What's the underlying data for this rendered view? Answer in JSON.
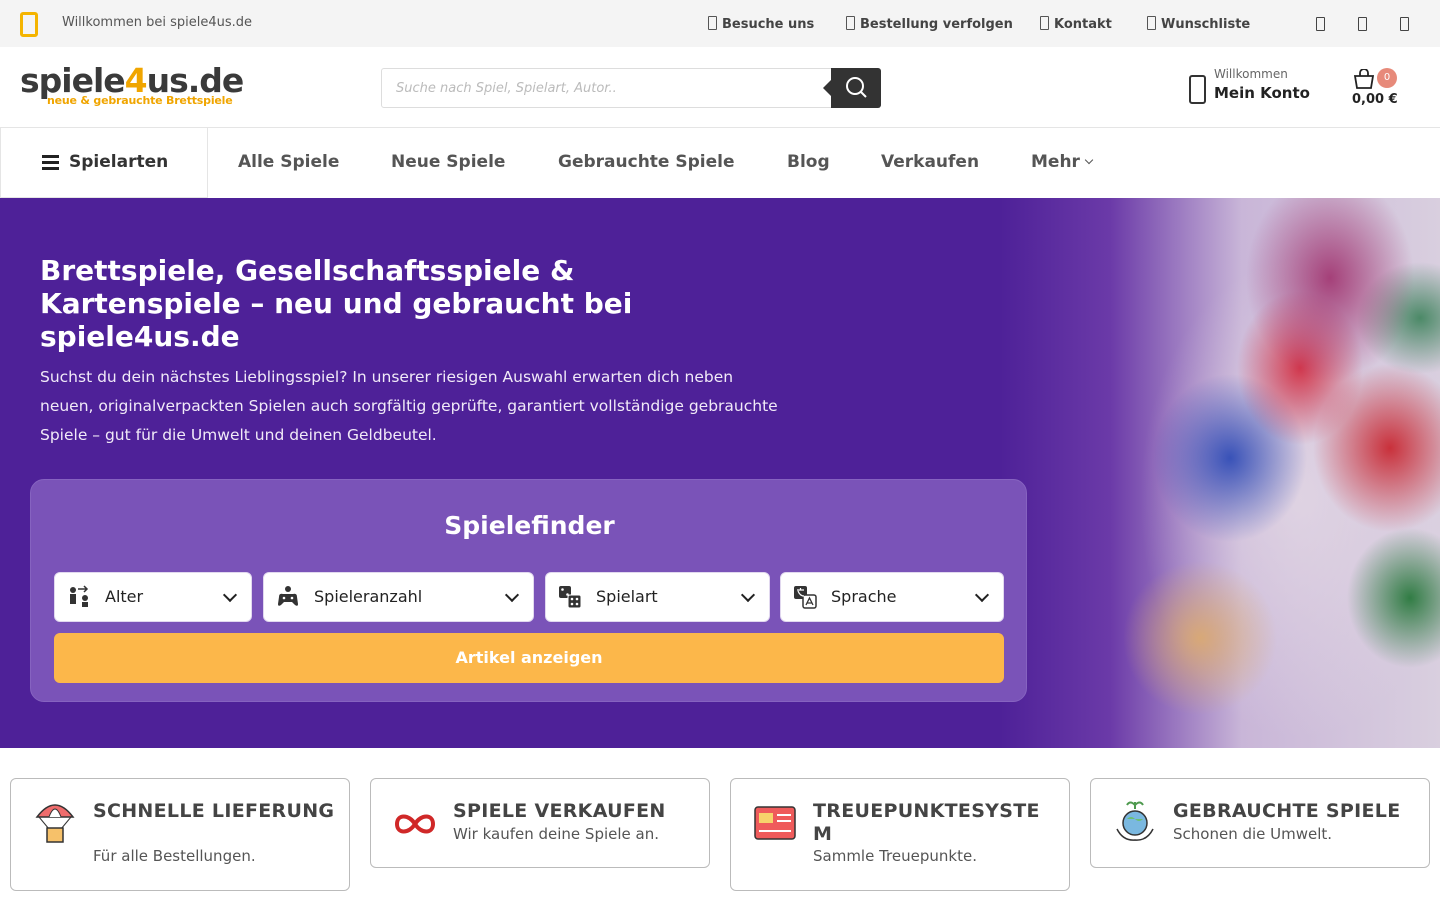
{
  "topbar": {
    "welcome": "Willkommen bei spiele4us.de",
    "links": [
      "Besuche uns",
      "Bestellung verfolgen",
      "Kontakt",
      "Wunschliste"
    ],
    "phone_icon": "phone-icon",
    "social_icons": [
      "facebook-icon",
      "instagram-icon",
      "youtube-icon"
    ]
  },
  "header": {
    "logo_main_a": "spiele",
    "logo_main_b": "4",
    "logo_main_c": "us.de",
    "logo_sub": "neue & gebrauchte Brettspiele",
    "search_placeholder": "Suche nach Spiel, Spielart, Autor..",
    "account_small": "Willkommen",
    "account_big": "Mein Konto",
    "cart_count": "0",
    "cart_total": "0,00 €"
  },
  "nav": {
    "categories": "Spielarten",
    "links": [
      "Alle Spiele",
      "Neue Spiele",
      "Gebrauchte Spiele",
      "Blog",
      "Verkaufen",
      "Mehr"
    ]
  },
  "hero": {
    "title": "Brettspiele, Gesellschaftsspiele & Kartenspiele – neu und gebraucht bei spiele4us.de",
    "text": "Suchst du dein nächstes Lieblingsspiel? In unserer riesigen Auswahl erwarten dich neben neuen, originalverpackten Spielen auch sorgfältig geprüfte, garantiert vollständige gebrauchte Spiele – gut für die Umwelt und deinen Geldbeutel.",
    "finder": {
      "title": "Spielefinder",
      "selects": [
        "Alter",
        "Spieleranzahl",
        "Spielart",
        "Sprache"
      ],
      "button": "Artikel anzeigen"
    }
  },
  "features": [
    {
      "title": "SCHNELLE LIEFERUNG",
      "sub": "Für alle Bestellungen.",
      "icon": "parachute-box-icon"
    },
    {
      "title": "SPIELE VERKAUFEN",
      "sub": "Wir kaufen deine Spiele an.",
      "icon": "infinity-icon"
    },
    {
      "title": "TREUEPUNKTESYSTE M",
      "sub": "Sammle Treuepunkte.",
      "icon": "loyalty-card-icon"
    },
    {
      "title": "GEBRAUCHTE SPIELE",
      "sub": "Schonen die Umwelt.",
      "icon": "eco-globe-icon"
    }
  ],
  "colors": {
    "accent": "#f0a500",
    "hero_bg": "#4e2198",
    "finder_btn": "#fcb74a"
  }
}
